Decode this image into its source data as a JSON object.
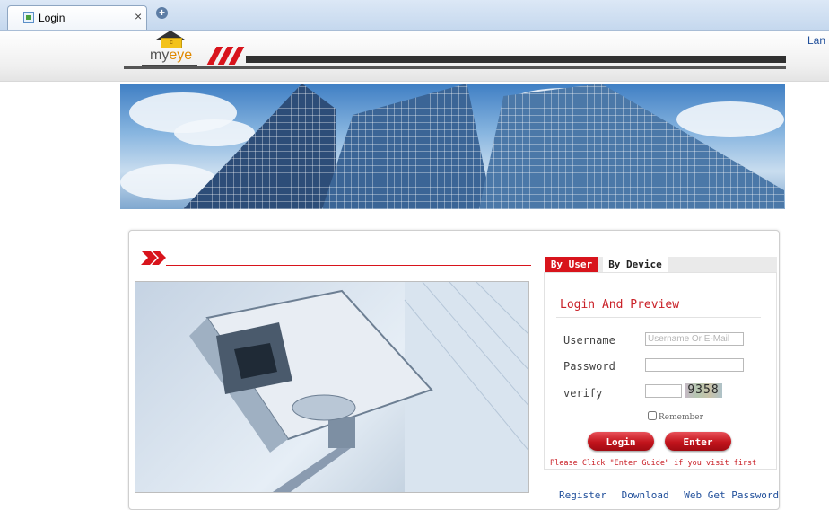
{
  "browser": {
    "tab_title": "Login",
    "tab_close": "×",
    "new_tab": "+"
  },
  "header": {
    "logo_box_text": "c",
    "logo_text_my": "my",
    "logo_text_eye": "eye",
    "language_link": "Lan"
  },
  "login": {
    "tabs": {
      "by_user": "By User",
      "by_device": "By Device"
    },
    "title": "Login And Preview",
    "username_label": "Username",
    "username_placeholder": "Username Or E-Mail",
    "username_value": "",
    "password_label": "Password",
    "password_value": "",
    "verify_label": "verify",
    "verify_value": "",
    "captcha": "9358",
    "remember_label": "Remember",
    "remember_checked": false,
    "login_button": "Login",
    "enter_guide_button": "Enter Guide",
    "hint": "Please Click \"Enter Guide\" if you visit first",
    "links": {
      "register": "Register",
      "download": "Download",
      "web_get_password": "Web Get Password"
    }
  },
  "colors": {
    "brand_red": "#d8141c",
    "link_blue": "#1f4e9a",
    "logo_orange": "#e08a00"
  }
}
